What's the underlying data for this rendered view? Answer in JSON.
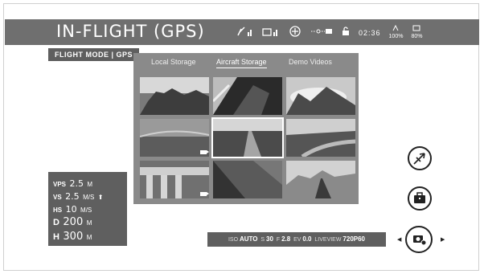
{
  "header": {
    "title": "IN-FLIGHT (GPS)",
    "time": "02:36",
    "aircraft_battery": "100%",
    "remote_battery": "80%",
    "signal_label": "IR"
  },
  "flight_mode": "FLIGHT MODE | GPS",
  "gallery": {
    "tabs": [
      {
        "label": "Local Storage",
        "active": false
      },
      {
        "label": "Aircraft Storage",
        "active": true
      },
      {
        "label": "Demo Videos",
        "active": false
      }
    ],
    "thumbnails": [
      {
        "scene": "desert-canyon",
        "video": false,
        "selected": false
      },
      {
        "scene": "aerial-coast",
        "video": false,
        "selected": false
      },
      {
        "scene": "cloudy-mountains",
        "video": false,
        "selected": false
      },
      {
        "scene": "plains-valley",
        "video": true,
        "selected": false
      },
      {
        "scene": "road-forest",
        "video": false,
        "selected": true
      },
      {
        "scene": "forest-river",
        "video": false,
        "selected": false
      },
      {
        "scene": "viaduct",
        "video": true,
        "selected": false
      },
      {
        "scene": "dark-forest",
        "video": false,
        "selected": false
      },
      {
        "scene": "desert-road",
        "video": false,
        "selected": false
      }
    ]
  },
  "telemetry": {
    "vps": {
      "label": "VPS",
      "value": "2.5",
      "unit": "M"
    },
    "vs": {
      "label": "VS",
      "value": "2.5",
      "unit": "M/S",
      "arrow": "⬆"
    },
    "hs": {
      "label": "HS",
      "value": "10",
      "unit": "M/S"
    },
    "d": {
      "label": "D",
      "value": "200",
      "unit": "M"
    },
    "h": {
      "label": "H",
      "value": "300",
      "unit": "M"
    }
  },
  "camera": {
    "iso_label": "ISO",
    "iso_value": "AUTO",
    "shutter_label": "S",
    "shutter_value": "30",
    "fstop_label": "F",
    "fstop_value": "2.8",
    "ev_label": "EV",
    "ev_value": "0.0",
    "liveview_label": "LIVEVIEW",
    "liveview_value": "720P60"
  },
  "buttons": {
    "takeoff_icon": "aircraft-icon",
    "toolbox_icon": "briefcase-icon",
    "camera_icon": "camera-settings-icon"
  },
  "colors": {
    "topbar": "#6f6f6f",
    "panel": "#5f5f5f",
    "gallery": "#8a8a8a"
  }
}
